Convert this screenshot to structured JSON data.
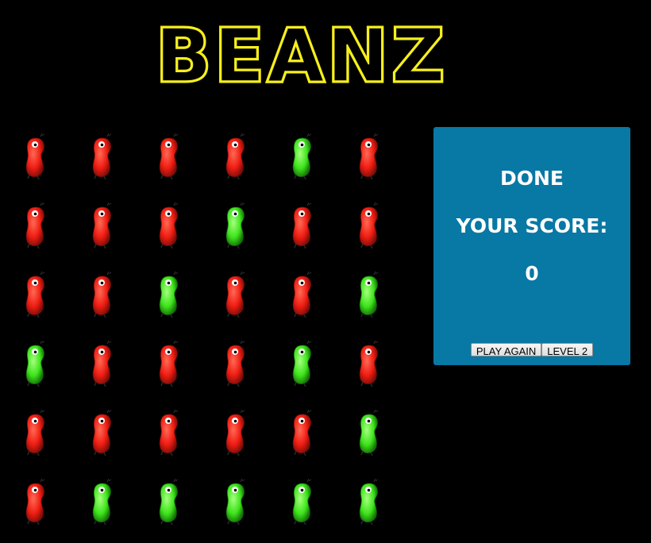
{
  "title": "BEANZ",
  "colors": {
    "background": "#000000",
    "logo": "#f6ef1c",
    "panel": "#0878a4",
    "bean_red": "#ef1d13",
    "bean_green": "#3ee41c"
  },
  "board": {
    "rows": [
      [
        "red",
        "red",
        "red",
        "red",
        "green",
        "red"
      ],
      [
        "red",
        "red",
        "red",
        "green",
        "red",
        "red"
      ],
      [
        "red",
        "red",
        "green",
        "red",
        "red",
        "green"
      ],
      [
        "green",
        "red",
        "red",
        "red",
        "green",
        "red"
      ],
      [
        "red",
        "red",
        "red",
        "red",
        "red",
        "green"
      ],
      [
        "red",
        "green",
        "green",
        "green",
        "green",
        "green"
      ]
    ]
  },
  "panel": {
    "status": "DONE",
    "score_label": "YOUR SCORE:",
    "score_value": "0",
    "play_again_label": "PLAY AGAIN",
    "level_label": "LEVEL 2"
  }
}
